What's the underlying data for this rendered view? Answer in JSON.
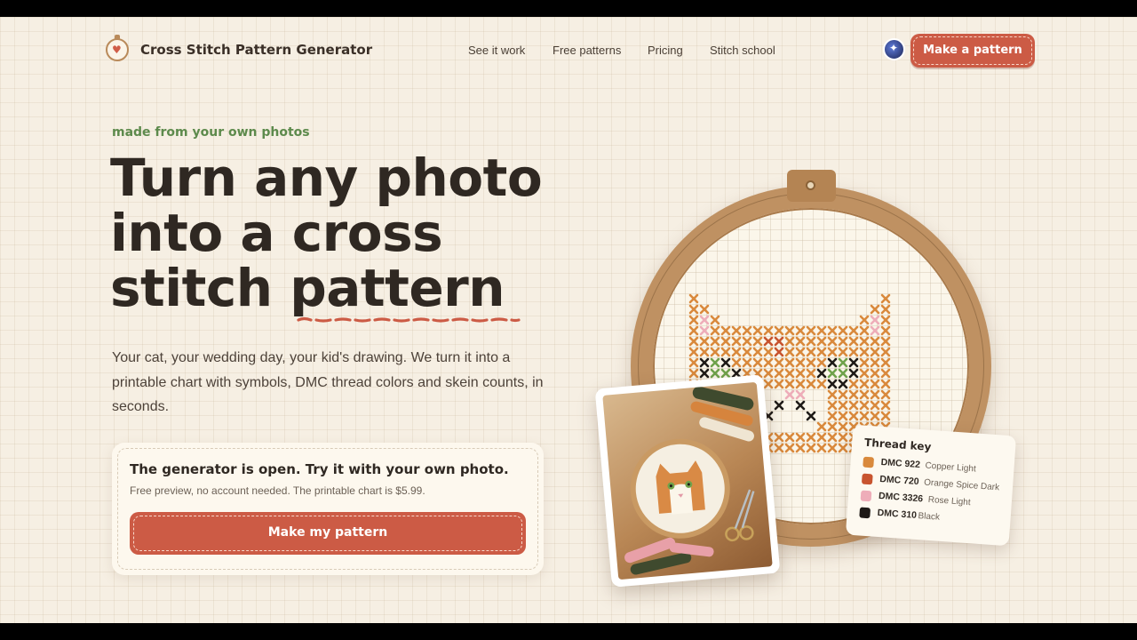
{
  "header": {
    "brand": "Cross Stitch Pattern Generator",
    "nav": [
      "See it work",
      "Free patterns",
      "Pricing",
      "Stitch school"
    ],
    "cta_label": "Make a pattern"
  },
  "hero": {
    "eyebrow": "made from your own photos",
    "headline_line1": "Turn any photo",
    "headline_line2": "into a cross",
    "headline_line3_prefix": "stitch ",
    "headline_line3_emph": "pattern",
    "lede": "Your cat, your wedding day, your kid's drawing. We turn it into a printable chart with symbols, DMC thread colors and skein counts, in seconds."
  },
  "generator_card": {
    "title": "The generator is open. Try it with your own photo.",
    "subtitle": "Free preview, no account needed. The printable chart is $5.99.",
    "button_label": "Make my pattern"
  },
  "thread_key": {
    "title": "Thread key",
    "threads": [
      {
        "code": "DMC 922",
        "name": "Copper Light",
        "color": "#d9893c"
      },
      {
        "code": "DMC 720",
        "name": "Orange Spice Dark",
        "color": "#c8542f"
      },
      {
        "code": "DMC 3326",
        "name": "Rose Light",
        "color": "#eeadb9"
      },
      {
        "code": "DMC 310",
        "name": "Black",
        "color": "#1e1a17"
      }
    ]
  },
  "colors": {
    "accent": "#cc5b45",
    "eyebrow_green": "#5d8a4c",
    "text_dark": "#2f2822",
    "background": "#f6efe3"
  },
  "icons": {
    "logo": "heart-hoop-icon",
    "avatar": "astronaut-avatar"
  }
}
